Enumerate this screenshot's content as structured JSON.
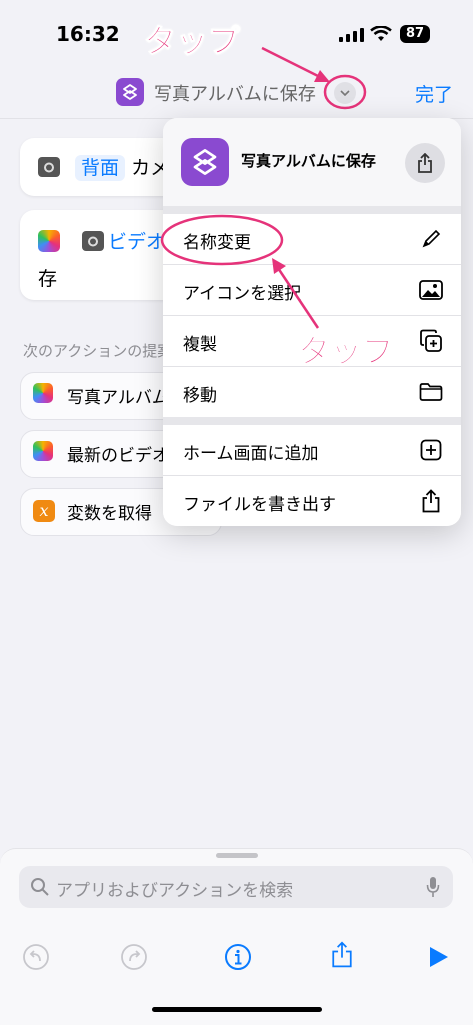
{
  "status_bar": {
    "time": "16:32",
    "battery": "87"
  },
  "nav": {
    "title": "写真アルバムに保存",
    "done_label": "完了"
  },
  "editor": {
    "action1": {
      "param": "背面",
      "text": "カメ"
    },
    "action2": {
      "param": "ビデオ",
      "text_line2": "存"
    },
    "next_actions_header": "次のアクションの提案",
    "suggestions": [
      {
        "label": "写真アルバムに",
        "icon": "photos-icon"
      },
      {
        "label": "最新のビデオを",
        "icon": "photos-icon"
      },
      {
        "label": "変数を取得",
        "icon": "variable-icon",
        "icon_text": "x"
      }
    ]
  },
  "menu": {
    "title": "写真アルバムに保存",
    "items": [
      {
        "label": "名称変更",
        "icon": "pencil-icon"
      },
      {
        "label": "アイコンを選択",
        "icon": "photo-icon"
      },
      {
        "label": "複製",
        "icon": "duplicate-icon"
      },
      {
        "label": "移動",
        "icon": "folder-icon"
      },
      {
        "label": "ホーム画面に追加",
        "icon": "plus-square-icon"
      },
      {
        "label": "ファイルを書き出す",
        "icon": "share-icon"
      }
    ]
  },
  "bottom": {
    "search_placeholder": "アプリおよびアクションを検索"
  },
  "annotations": {
    "tap_top": "タップ",
    "tap_middle": "タップ"
  },
  "colors": {
    "accent": "#0a7bff",
    "annotation": "#e5337a",
    "shortcut_icon": "#8a4ad0"
  }
}
